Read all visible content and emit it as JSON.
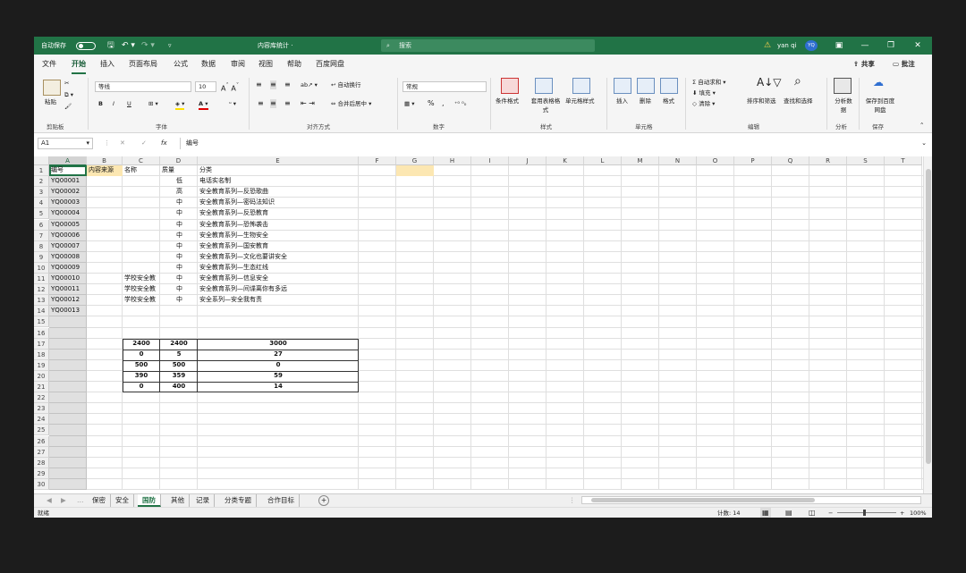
{
  "titlebar": {
    "autosave": "自动保存",
    "autosave_state": "关",
    "filename": "内容库统计 ·",
    "search_placeholder": "搜索",
    "user": "yan qi",
    "user_initials": "YQ",
    "warn_icon": "warning-icon",
    "ctl_ribbon": "▣",
    "ctl_min": "—",
    "ctl_max": "❐",
    "ctl_close": "✕"
  },
  "menu": {
    "tabs": [
      "文件",
      "开始",
      "插入",
      "页面布局",
      "公式",
      "数据",
      "审阅",
      "视图",
      "帮助",
      "百度网盘"
    ],
    "share": "共享",
    "comment": "批注"
  },
  "ribbon": {
    "paste": "粘贴",
    "clipboard": "剪贴板",
    "font_name": "等线",
    "font_size": "10",
    "bold": "B",
    "italic": "I",
    "underline": "U",
    "font_group": "字体",
    "wrap": "自动换行",
    "merge": "合并后居中",
    "align_group": "对齐方式",
    "numfmt": "常规",
    "num_group": "数字",
    "pct": "%",
    "comma": ",",
    "cond": "条件格式",
    "table": "套用表格格式",
    "cellstyle": "单元格样式",
    "style_group": "样式",
    "insert": "插入",
    "delete": "删除",
    "format": "格式",
    "cells_group": "单元格",
    "autosum": "自动求和",
    "fill": "填充",
    "clear": "清除",
    "sort": "排序和筛选",
    "find": "查找和选择",
    "edit_group": "编辑",
    "analyze": "分析数据",
    "analyze_group": "分析",
    "save_baidu": "保存到百度网盘",
    "save_group": "保存"
  },
  "formula_bar": {
    "name_box": "A1",
    "fx": "fx",
    "value": "编号"
  },
  "columns": [
    "A",
    "B",
    "C",
    "D",
    "E",
    "F",
    "G",
    "H",
    "I",
    "J",
    "K",
    "L",
    "M",
    "N",
    "O",
    "P",
    "Q",
    "R",
    "S",
    "T"
  ],
  "rows": [
    "1",
    "2",
    "3",
    "4",
    "5",
    "6",
    "7",
    "8",
    "9",
    "10",
    "11",
    "12",
    "13",
    "14",
    "15",
    "16",
    "17",
    "18",
    "19",
    "20",
    "21",
    "22",
    "23",
    "24",
    "25",
    "26",
    "27",
    "28",
    "29",
    "30"
  ],
  "header_row": [
    "编号",
    "内容来源",
    "名称",
    "质量",
    "分类"
  ],
  "data_rows": [
    {
      "id": "YQ00001",
      "name": "",
      "quality": "低",
      "cat": "电话实名制"
    },
    {
      "id": "YQ00002",
      "name": "",
      "quality": "高",
      "cat": "安全教育系列—反恐歌曲"
    },
    {
      "id": "YQ00003",
      "name": "",
      "quality": "中",
      "cat": "安全教育系列—密码法知识"
    },
    {
      "id": "YQ00004",
      "name": "",
      "quality": "中",
      "cat": "安全教育系列—反恐教育"
    },
    {
      "id": "YQ00005",
      "name": "",
      "quality": "中",
      "cat": "安全教育系列—恐怖袭击"
    },
    {
      "id": "YQ00006",
      "name": "",
      "quality": "中",
      "cat": "安全教育系列—生物安全"
    },
    {
      "id": "YQ00007",
      "name": "",
      "quality": "中",
      "cat": "安全教育系列—国安教育"
    },
    {
      "id": "YQ00008",
      "name": "",
      "quality": "中",
      "cat": "安全教育系列—文化也要讲安全"
    },
    {
      "id": "YQ00009",
      "name": "",
      "quality": "中",
      "cat": "安全教育系列—生态红线"
    },
    {
      "id": "YQ00010",
      "name": "学校安全教",
      "quality": "中",
      "cat": "安全教育系列—信息安全"
    },
    {
      "id": "YQ00011",
      "name": "学校安全教",
      "quality": "中",
      "cat": "安全教育系列—间谍离你有多远"
    },
    {
      "id": "YQ00012",
      "name": "学校安全教",
      "quality": "中",
      "cat": "安全系列—安全我有责"
    },
    {
      "id": "YQ00013",
      "name": "",
      "quality": "",
      "cat": ""
    }
  ],
  "stats_table": [
    [
      "2400",
      "2400",
      "3000"
    ],
    [
      "0",
      "5",
      "27"
    ],
    [
      "500",
      "500",
      "0"
    ],
    [
      "390",
      "359",
      "59"
    ],
    [
      "0",
      "400",
      "14"
    ]
  ],
  "sheet_tabs": [
    "保密",
    "安全",
    "国防",
    "其他",
    "记录",
    "分类专题",
    "合作目标"
  ],
  "active_sheet_index": 2,
  "status": {
    "ready": "就绪",
    "count": "计数: 14",
    "zoom": "100%"
  }
}
